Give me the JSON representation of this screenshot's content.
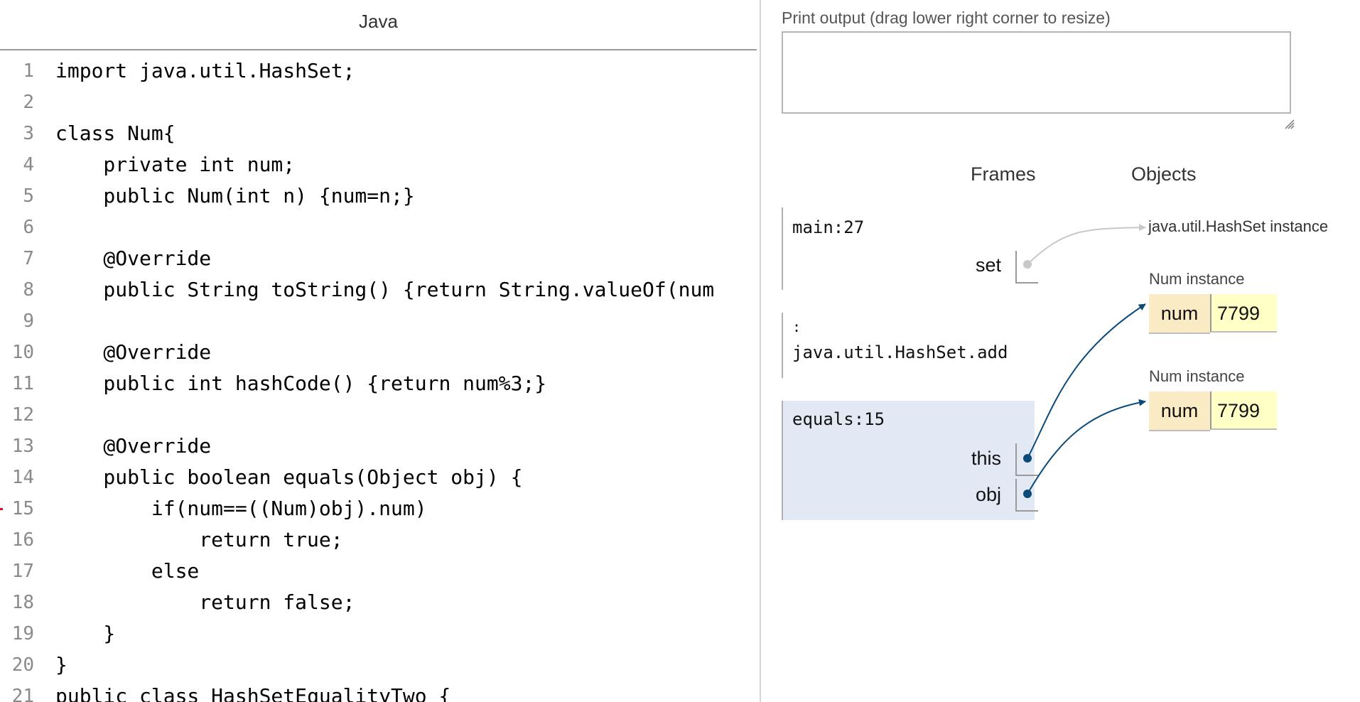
{
  "code_panel": {
    "language": "Java",
    "current_line": "15",
    "lines": [
      {
        "num": "1",
        "text": "import java.util.HashSet;"
      },
      {
        "num": "2",
        "text": ""
      },
      {
        "num": "3",
        "text": "class Num{"
      },
      {
        "num": "4",
        "text": "    private int num;"
      },
      {
        "num": "5",
        "text": "    public Num(int n) {num=n;}"
      },
      {
        "num": "6",
        "text": ""
      },
      {
        "num": "7",
        "text": "    @Override"
      },
      {
        "num": "8",
        "text": "    public String toString() {return String.valueOf(num"
      },
      {
        "num": "9",
        "text": ""
      },
      {
        "num": "10",
        "text": "    @Override"
      },
      {
        "num": "11",
        "text": "    public int hashCode() {return num%3;}"
      },
      {
        "num": "12",
        "text": ""
      },
      {
        "num": "13",
        "text": "    @Override"
      },
      {
        "num": "14",
        "text": "    public boolean equals(Object obj) {"
      },
      {
        "num": "15",
        "text": "        if(num==((Num)obj).num)"
      },
      {
        "num": "16",
        "text": "            return true;"
      },
      {
        "num": "17",
        "text": "        else"
      },
      {
        "num": "18",
        "text": "            return false;"
      },
      {
        "num": "19",
        "text": "    }"
      },
      {
        "num": "20",
        "text": "}"
      },
      {
        "num": "21",
        "text": "public class HashSetEqualityTwo {"
      }
    ]
  },
  "print_output": {
    "label": "Print output (drag lower right corner to resize)",
    "content": ""
  },
  "viz": {
    "frames_header": "Frames",
    "objects_header": "Objects",
    "frames": [
      {
        "name": "main:27",
        "vars": [
          {
            "name": "set",
            "pointer": "java.util.HashSet instance"
          }
        ]
      },
      {
        "name": "java.util.HashSet.add",
        "prefix": ":"
      },
      {
        "name": "equals:15",
        "vars": [
          {
            "name": "this"
          },
          {
            "name": "obj"
          }
        ]
      }
    ],
    "objects": [
      {
        "label": "java.util.HashSet instance"
      },
      {
        "label": "Num instance",
        "field": "num",
        "value": "7799"
      },
      {
        "label": "Num instance",
        "field": "num",
        "value": "7799"
      }
    ],
    "colors": {
      "active_frame_bg": "#e2e9f5",
      "pointer_active": "#0c4a7a",
      "pointer_inactive": "#c8c8c8"
    }
  }
}
